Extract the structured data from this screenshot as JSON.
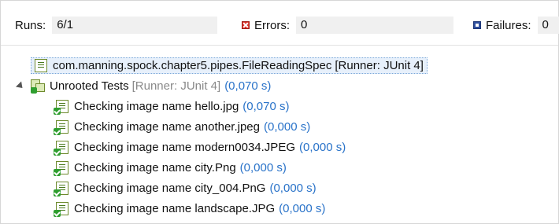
{
  "counters": {
    "runs_label": "Runs:",
    "runs_value": "6/1",
    "errors_label": "Errors:",
    "errors_value": "0",
    "failures_label": "Failures:",
    "failures_value": "0"
  },
  "tree": {
    "spec": {
      "name": "com.manning.spock.chapter5.pipes.FileReadingSpec",
      "runner": "[Runner: JUnit 4]"
    },
    "unrooted": {
      "name": "Unrooted Tests",
      "runner": "[Runner: JUnit 4]",
      "time": "(0,070 s)"
    },
    "tests": [
      {
        "name": "Checking image name hello.jpg",
        "time": "(0,070 s)"
      },
      {
        "name": "Checking image name another.jpeg",
        "time": "(0,000 s)"
      },
      {
        "name": "Checking image name modern0034.JPEG",
        "time": "(0,000 s)"
      },
      {
        "name": "Checking image name city.Png",
        "time": "(0,000 s)"
      },
      {
        "name": "Checking image name city_004.PnG",
        "time": "(0,000 s)"
      },
      {
        "name": "Checking image name landscape.JPG",
        "time": "(0,000 s)"
      }
    ]
  },
  "colors": {
    "time_text": "#2a73c9",
    "runner_text": "#8a8a8a",
    "error_icon": "#d9322a",
    "failure_icon": "#2f4f9e",
    "pass_check": "#2f9e2f"
  },
  "icons": {
    "errors": "error-icon",
    "failures": "failure-icon",
    "test": "test-passed-icon",
    "suite": "suite-passed-icon"
  }
}
